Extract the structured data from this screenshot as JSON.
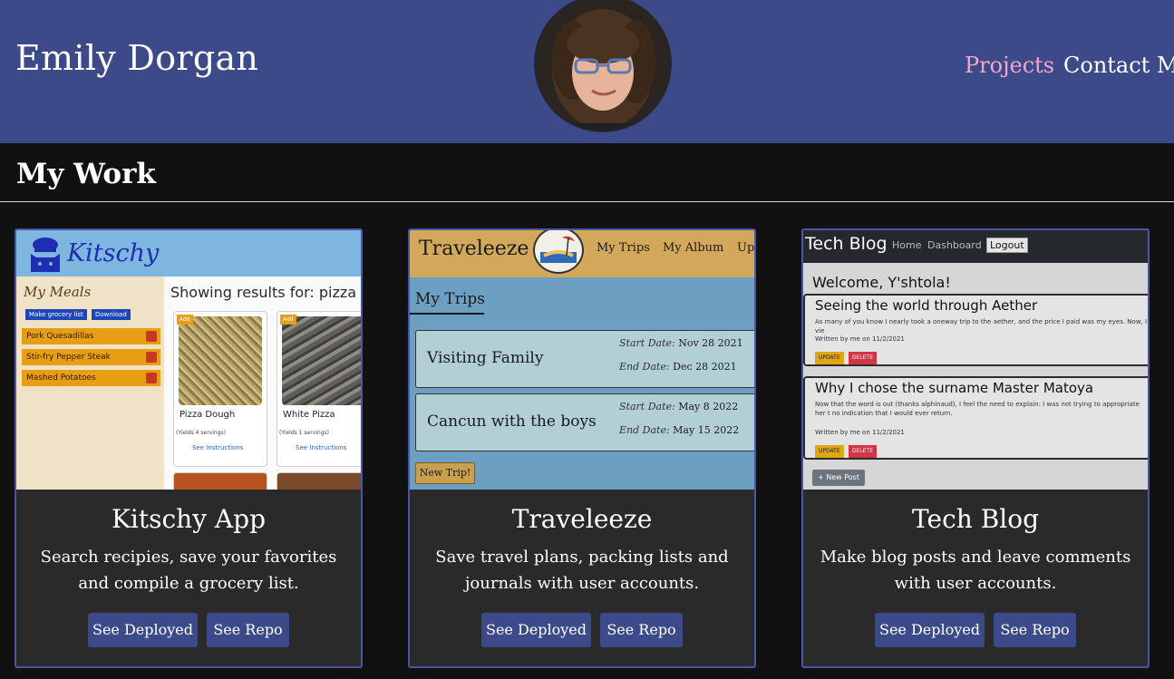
{
  "header": {
    "site_name": "Emily Dorgan",
    "nav": {
      "projects": "Projects",
      "contact": "Contact Me"
    },
    "colors": {
      "header_bg": "#3d4a8a",
      "nav_active": "#f4a6c6"
    }
  },
  "section": {
    "title": "My Work"
  },
  "projects": [
    {
      "title": "Kitschy App",
      "description": "Search recipies, save your favorites and compile a grocery list.",
      "deployed_label": "See Deployed",
      "repo_label": "See Repo",
      "screenshot": {
        "logo": "Kitschy",
        "sidebar_title": "My Meals",
        "grocery_btn": "Make grocery list",
        "download_btn": "Download",
        "meals": [
          "Pork Quesadillas",
          "Stir-fry Pepper Steak",
          "Mashed Potatoes"
        ],
        "results_heading": "Showing results for: pizza",
        "add_label": "Add",
        "recipes": [
          {
            "name": "Pizza Dough",
            "yields": "(Yields 4 servings)",
            "link": "See Instructions"
          },
          {
            "name": "White Pizza",
            "yields": "(Yields 1 servings)",
            "link": "See Instructions"
          }
        ]
      }
    },
    {
      "title": "Traveleeze",
      "description": "Save travel plans, packing lists and journals with user accounts.",
      "deployed_label": "See Deployed",
      "repo_label": "See Repo",
      "screenshot": {
        "logo": "Traveleeze",
        "nav": [
          "My Trips",
          "My Album",
          "Upl"
        ],
        "heading": "My Trips",
        "start_label": "Start Date:",
        "end_label": "End Date:",
        "trips": [
          {
            "name": "Visiting Family",
            "start": "Nov 28 2021",
            "end": "Dec 28 2021"
          },
          {
            "name": "Cancun with the boys",
            "start": "May 8 2022",
            "end": "May 15 2022"
          }
        ],
        "new_trip": "New Trip!"
      }
    },
    {
      "title": "Tech Blog",
      "description": "Make blog posts and leave comments with user accounts.",
      "deployed_label": "See Deployed",
      "repo_label": "See Repo",
      "screenshot": {
        "logo": "Tech Blog",
        "nav": [
          "Home",
          "Dashboard"
        ],
        "logout": "Logout",
        "welcome": "Welcome, Y'shtola!",
        "posts": [
          {
            "title": "Seeing the world through Aether",
            "body": "As many of you know I nearly took a oneway trip to the aether, and the price I paid was my eyes. Now, I vie",
            "meta": "Written by me on 11/2/2021"
          },
          {
            "title": "Why I chose the surname Master Matoya",
            "body": "Now that the word is out (thanks alphinaud), I feel the need to explain: I was not trying to appropriate her t no indication that I would ever return.",
            "meta": "Written by me on 11/2/2021"
          }
        ],
        "update": "UPDATE",
        "delete": "DELETE",
        "new_post": "+ New Post"
      }
    }
  ]
}
